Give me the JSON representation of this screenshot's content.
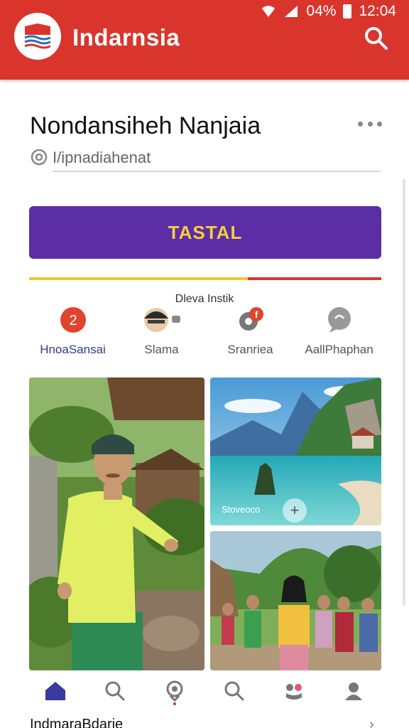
{
  "status_bar": {
    "battery": "04%",
    "time": "12:04"
  },
  "app_bar": {
    "title": "Indarnsia"
  },
  "profile": {
    "name": "Nondansiheh Nanjaia",
    "handle": "I/ipnadiahenat"
  },
  "primary_button": {
    "label": "TASTAL"
  },
  "section_label": "Dleva Instik",
  "categories": [
    {
      "label": "HnoaSansai",
      "icon": "badge-2-icon",
      "badge": "2"
    },
    {
      "label": "Slama",
      "icon": "person-chat-icon"
    },
    {
      "label": "Sranriea",
      "icon": "gear-notification-icon"
    },
    {
      "label": "AallPhaphan",
      "icon": "chat-bubble-icon"
    }
  ],
  "photos": [
    {
      "icon": "photo-man-village"
    },
    {
      "icon": "photo-lagoon",
      "caption": "Stoveoco"
    },
    {
      "icon": "photo-group-women"
    }
  ],
  "bottom_nav": [
    {
      "icon": "home-icon"
    },
    {
      "icon": "search-icon"
    },
    {
      "icon": "location-icon"
    },
    {
      "icon": "search-icon"
    },
    {
      "icon": "community-icon"
    },
    {
      "icon": "profile-icon"
    }
  ],
  "footer_peek": "IndmaraBdarie",
  "colors": {
    "brand_red": "#d9352d",
    "brand_purple": "#5b2ea6",
    "accent_yellow": "#f0c531",
    "nav_active": "#2d3a8c"
  }
}
